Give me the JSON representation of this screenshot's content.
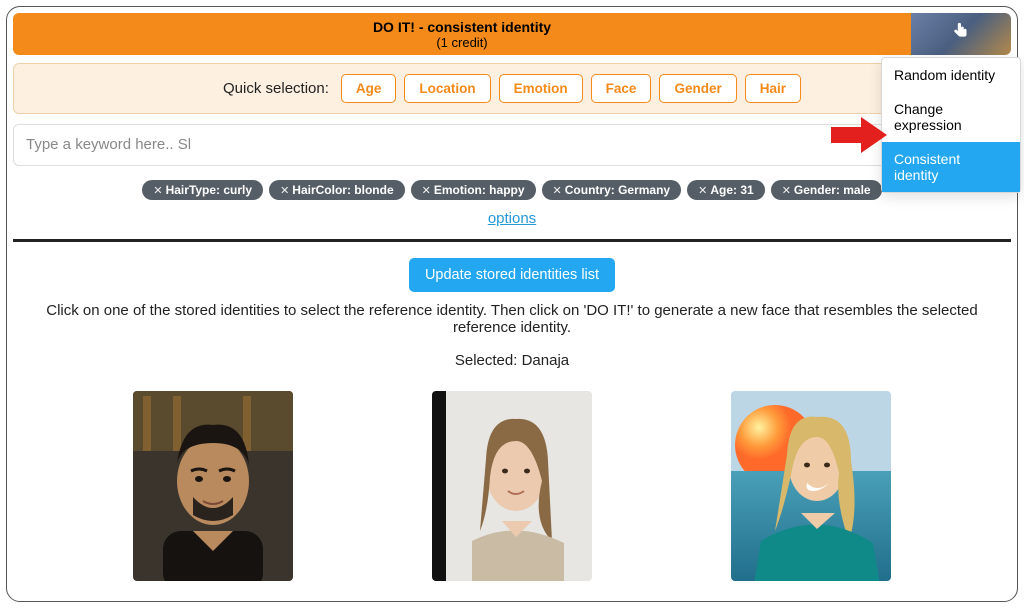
{
  "header": {
    "do_it_title": "DO IT! - consistent identity",
    "do_it_subtitle": "(1 credit)"
  },
  "dropdown": {
    "items": [
      {
        "label": "Random identity",
        "active": false
      },
      {
        "label": "Change expression",
        "active": false
      },
      {
        "label": "Consistent identity",
        "active": true
      }
    ]
  },
  "quick": {
    "label": "Quick selection:",
    "buttons": [
      "Age",
      "Location",
      "Emotion",
      "Face",
      "Gender",
      "Hair"
    ]
  },
  "search": {
    "placeholder": "Type a keyword here.. Sl",
    "value": ""
  },
  "tags": [
    "HairType: curly",
    "HairColor: blonde",
    "Emotion: happy",
    "Country: Germany",
    "Age: 31",
    "Gender: male"
  ],
  "links": {
    "options": "options"
  },
  "actions": {
    "update_stored": "Update stored identities list"
  },
  "help": "Click on one of the stored identities to select the reference identity. Then click on 'DO IT!' to generate a new face that resembles the selected reference identity.",
  "selected": {
    "prefix": "Selected: ",
    "name": "Danaja"
  },
  "identities": [
    {
      "alt": "man-curly-dark-hair"
    },
    {
      "alt": "woman-light-brown-hair-beige"
    },
    {
      "alt": "woman-blonde-teal-dress-sunset"
    }
  ]
}
